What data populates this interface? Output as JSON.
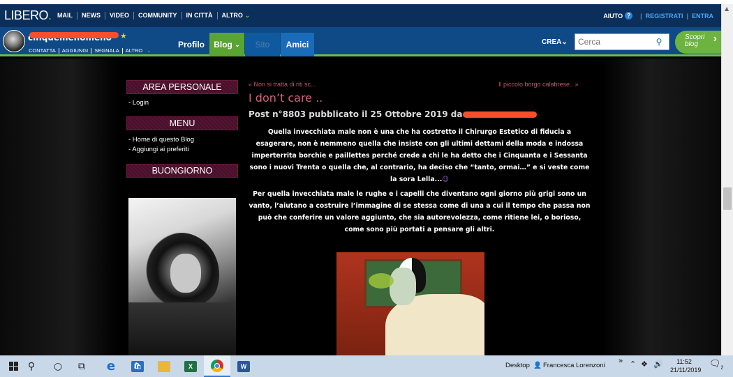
{
  "libero": {
    "logo": "LIBERO",
    "nav": [
      "MAIL",
      "NEWS",
      "VIDEO",
      "COMMUNITY",
      "IN CITTÀ",
      "ALTRO"
    ],
    "right": {
      "help": "AIUTO",
      "register": "REGISTRATI",
      "login": "ENTRA"
    }
  },
  "blogbar": {
    "name": "cinquemenomeno",
    "links": [
      "CONTATTA",
      "AGGIUNGI",
      "SEGNALA",
      "ALTRO"
    ],
    "tabs": {
      "profilo": "Profilo",
      "blog": "Blog",
      "sito": "Sito",
      "amici": "Amici"
    },
    "crea": "CREA",
    "search_placeholder": "Cerca",
    "scopri_line1": "Scopri",
    "scopri_line2": "blog"
  },
  "sidebar": {
    "area_personale": "AREA PERSONALE",
    "login": "- Login",
    "menu": "MENU",
    "home": "- Home di questo Blog",
    "favorites": "- Aggiungi ai preferiti",
    "buongiorno": "BUONGIORNO"
  },
  "post": {
    "prev": "« Non si tratta di riti sc...",
    "next": "Il piccolo borgo calabrese.. »",
    "title": "I don’t care ..",
    "meta": "Post n°8803 pubblicato il 25 Ottobre 2019 da",
    "para1": "Quella invecchiata male non è una che ha costretto il Chirurgo Estetico di fiducia a esagerare, non è nemmeno quella che insiste con gli ultimi dettami della moda e indossa imperterrita borchie e paillettes perché crede a chi le ha detto che i Cinquanta e i Sessanta sono i nuovi Trenta o quella che, al contrario, ha deciso che “tanto, ormai…” e si veste come la sora Lella...",
    "para2": "Per quella invecchiata male le rughe e i capelli che diventano ogni giorno più grigi sono un vanto, l’aiutano a costruire l’immagine di se stessa come di una a cui il tempo che passa non può che conferire un valore aggiunto, che sia autorevolezza, come ritiene lei, o borioso, come sono più portati a pensare gli altri."
  },
  "taskbar": {
    "desktop": "Desktop",
    "user": "Francesca Lorenzoni",
    "time": "11:52",
    "date": "21/11/2019",
    "notif_count": "2"
  },
  "colors": {
    "libero_blue": "#0b2f5a",
    "blog_green": "#6cc04a",
    "post_pink": "#d8607e"
  }
}
